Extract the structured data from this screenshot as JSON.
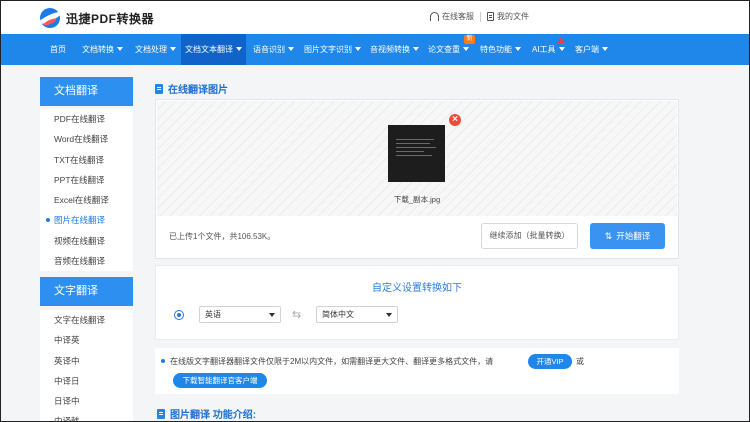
{
  "header": {
    "brand": "迅捷PDF转换器",
    "support_label": "在线客服",
    "my_files_label": "我的文件"
  },
  "nav": {
    "items": [
      {
        "label": "首页",
        "dropdown": false
      },
      {
        "label": "文档转换",
        "dropdown": true
      },
      {
        "label": "文档处理",
        "dropdown": true
      },
      {
        "label": "文档文本翻译",
        "dropdown": true,
        "active": true
      },
      {
        "label": "语音识别",
        "dropdown": true
      },
      {
        "label": "图片文字识别",
        "dropdown": true
      },
      {
        "label": "音视频转换",
        "dropdown": true
      },
      {
        "label": "论文查重",
        "dropdown": true
      },
      {
        "label": "特色功能",
        "dropdown": true
      },
      {
        "label": "AI工具",
        "dropdown": true
      },
      {
        "label": "客户端",
        "dropdown": true
      }
    ],
    "new_badge": "新"
  },
  "sidebar": {
    "doc_translate": {
      "title": "文档翻译",
      "items": [
        "PDF在线翻译",
        "Word在线翻译",
        "TXT在线翻译",
        "PPT在线翻译",
        "Excel在线翻译",
        "图片在线翻译",
        "视频在线翻译",
        "音频在线翻译"
      ],
      "active_index": 5
    },
    "text_translate": {
      "title": "文字翻译",
      "items": [
        "文字在线翻译",
        "中译英",
        "英译中",
        "中译日",
        "日译中",
        "中译韩"
      ]
    }
  },
  "main": {
    "section_title": "在线翻译图片",
    "file_name": "下载_副本.jpg",
    "upload_status": "已上传1个文件，共106.53K。",
    "continue_button": "继续添加（批量转换）",
    "start_button": "开始翻译",
    "settings_title": "自定义设置转换如下",
    "source_lang": "英语",
    "target_lang": "简体中文",
    "notice_text": "在线版文字翻译器翻译文件仅限于2M以内文件，如需翻译更大文件、翻译更多格式文件，请",
    "vip_button": "开通VIP",
    "notice_or": "或",
    "download_client_button": "下载智能翻译官客户端",
    "intro_title": "图片翻译 功能介绍:"
  },
  "colors": {
    "nav_bg": "#1f86ea",
    "nav_active": "#0f63c9",
    "accent": "#1f7be6",
    "close_red": "#ef4d3c"
  }
}
